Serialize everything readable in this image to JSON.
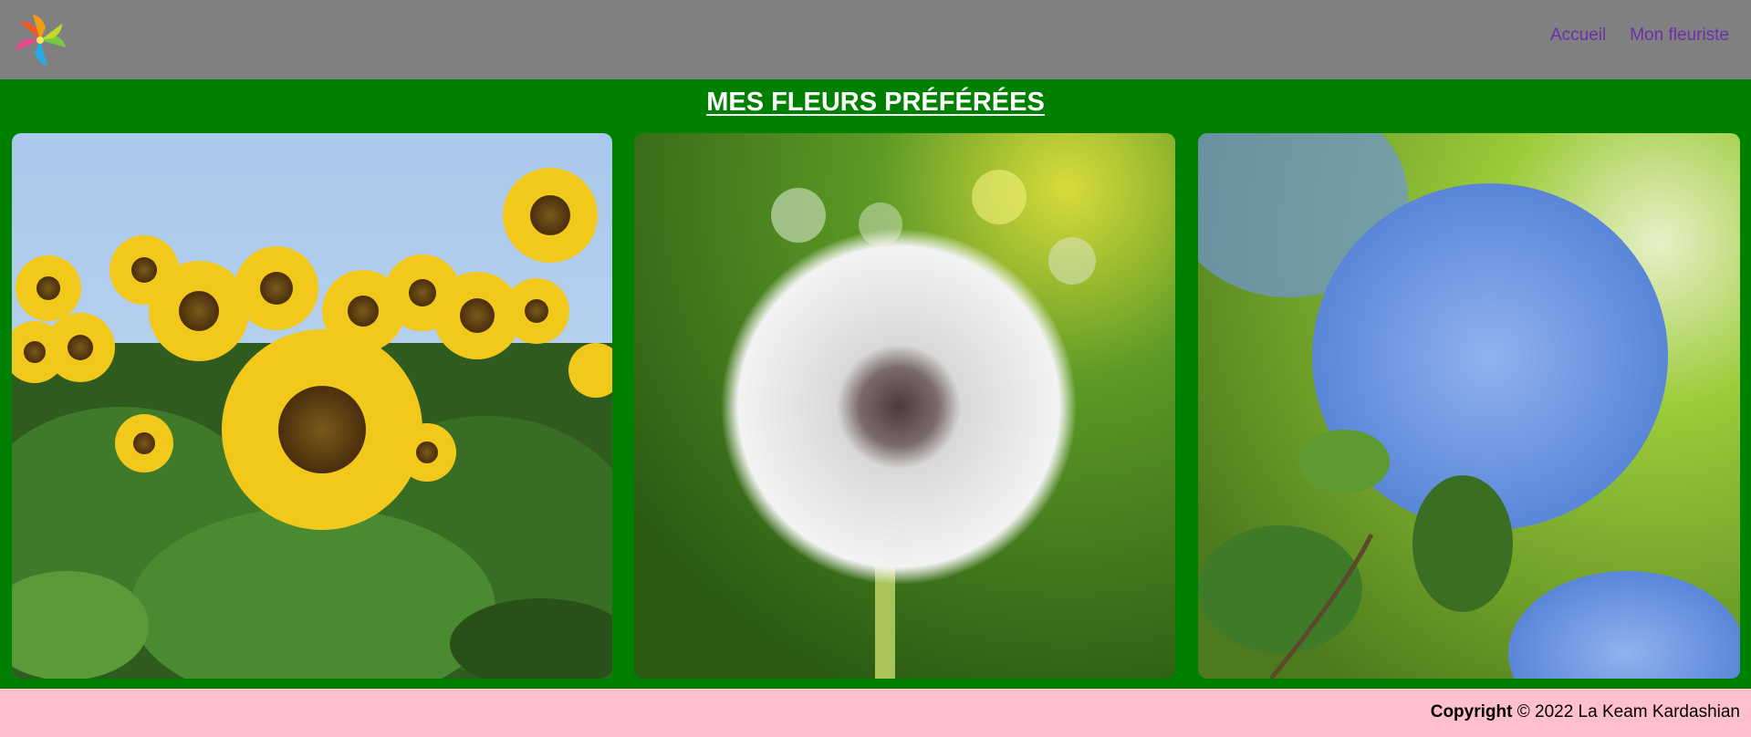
{
  "nav": {
    "items": [
      {
        "label": "Accueil"
      },
      {
        "label": "Mon fleuriste"
      }
    ]
  },
  "main": {
    "title": "MES FLEURS PRÉFÉRÉES",
    "photos": [
      {
        "subject": "sunflowers"
      },
      {
        "subject": "dandelion"
      },
      {
        "subject": "hydrangea"
      }
    ]
  },
  "footer": {
    "copyright_label": "Copyright",
    "copyright_text": "© 2022 La Keam Kardashian"
  },
  "colors": {
    "header_bg": "#808080",
    "main_bg": "#008000",
    "footer_bg": "#ffc0cb",
    "nav_link": "#6b2fa8",
    "title": "#ffffff"
  }
}
